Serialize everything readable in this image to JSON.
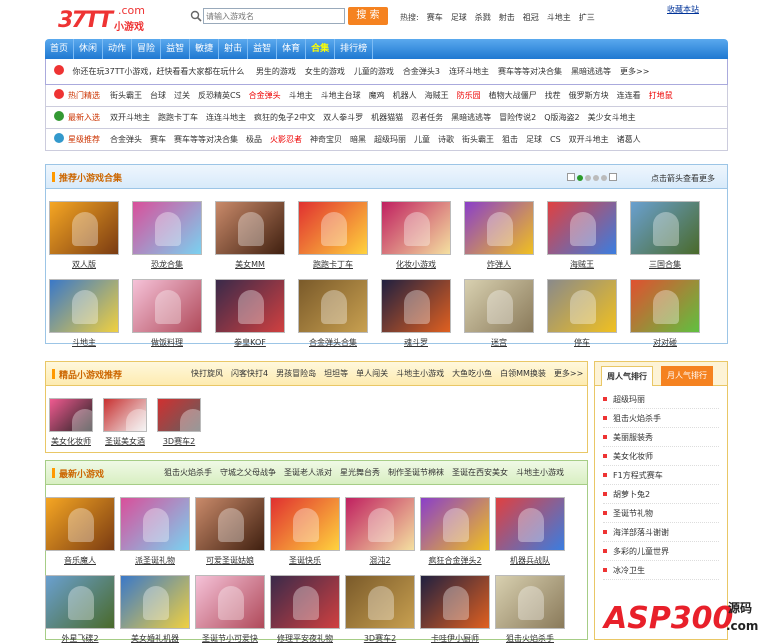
{
  "header": {
    "logo_main": "37TT",
    "logo_com": ".com",
    "logo_sub": "小游戏",
    "search_placeholder": "请输入游戏名",
    "search_button": "搜 索",
    "hot_label": "热搜:",
    "hot_words": [
      "赛车",
      "足球",
      "杀戮",
      "射击",
      "祖冠",
      "斗地主",
      "扩三"
    ],
    "favorite": "收藏本站"
  },
  "nav": {
    "items": [
      "首页",
      "休闲",
      "动作",
      "冒险",
      "益智",
      "敏捷",
      "射击",
      "益智",
      "体育",
      "合集",
      "排行榜"
    ],
    "active_index": 9
  },
  "welcome": {
    "text": "你还在玩37TT小游戏，赶快看看大家都在玩什么",
    "links": [
      "男生的游戏",
      "女生的游戏",
      "儿童的游戏",
      "合金弹头3",
      "连环斗地主",
      "赛车等等对决合集",
      "黑暗逃逃等",
      "更多>>"
    ]
  },
  "rows": [
    {
      "title": "热门精选",
      "color": "#e33",
      "items": [
        {
          "t": "街头霸王"
        },
        {
          "t": "台球"
        },
        {
          "t": "过关"
        },
        {
          "t": "反恐精英CS"
        },
        {
          "t": "合金弹头",
          "red": true
        },
        {
          "t": "斗地主"
        },
        {
          "t": "斗地主台球"
        },
        {
          "t": "魔鸡"
        },
        {
          "t": "机器人"
        },
        {
          "t": "海贼王"
        },
        {
          "t": "防乐园",
          "red": true
        },
        {
          "t": "植物大战僵尸"
        },
        {
          "t": "找茬"
        },
        {
          "t": "俄罗斯方块"
        },
        {
          "t": "连连看"
        },
        {
          "t": "打地鼠",
          "red": true
        }
      ]
    },
    {
      "title": "最新入选",
      "color": "#393",
      "items": [
        {
          "t": "双开斗地主"
        },
        {
          "t": "跑跑卡丁车"
        },
        {
          "t": "连连斗地主"
        },
        {
          "t": "疯狂的兔子2中文"
        },
        {
          "t": "双人拳斗罗"
        },
        {
          "t": "机器猫猫"
        },
        {
          "t": "忍者任务"
        },
        {
          "t": "黑暗逃逃等"
        },
        {
          "t": "冒险传说2"
        },
        {
          "t": "Q版海盗2"
        },
        {
          "t": "美少女斗地主"
        }
      ]
    },
    {
      "title": "星级推荐",
      "color": "#39c",
      "items": [
        {
          "t": "合金弹头"
        },
        {
          "t": "赛车"
        },
        {
          "t": "赛车等等对决合集"
        },
        {
          "t": "极品"
        },
        {
          "t": "火影忍者",
          "red": true
        },
        {
          "t": "神奇宝贝"
        },
        {
          "t": "暗黑"
        },
        {
          "t": "超级玛丽"
        },
        {
          "t": "儿童"
        },
        {
          "t": "诗歌"
        },
        {
          "t": "街头霸王"
        },
        {
          "t": "狙击"
        },
        {
          "t": "足球"
        },
        {
          "t": "CS"
        },
        {
          "t": "双开斗地主"
        },
        {
          "t": "诸葛人"
        }
      ]
    }
  ],
  "recommend": {
    "title": "推荐小游戏合集",
    "more": "点击箭头查看更多",
    "games": [
      "双人版",
      "恐龙合集",
      "美女MM",
      "跑跑卡丁车",
      "化妆小游戏",
      "炸弹人",
      "海贼王",
      "三国合集",
      "斗地主",
      "做饭料理",
      "拳皇KOF",
      "合金弹头合集",
      "魂斗罗",
      "迷宫",
      "停车",
      "对对碰"
    ]
  },
  "picks": {
    "title": "精品小游戏推荐",
    "links": [
      "快打旋风",
      "闪客快打4",
      "男孩冒险岛",
      "坦坦等",
      "单人闯关",
      "斗地主小游戏",
      "大鱼吃小鱼",
      "白领MM换装",
      "更多>>"
    ],
    "games": [
      "美女化妆师",
      "圣诞美女酒",
      "3D赛车2"
    ]
  },
  "newest": {
    "title": "最新小游戏",
    "links": [
      "狙击火焰杀手",
      "守城之父母战争",
      "圣诞老人派对",
      "星光舞台秀",
      "制作圣诞节棉袜",
      "圣诞在西安美女",
      "斗地主小游戏"
    ],
    "games": [
      "音乐魔人",
      "派圣诞礼物",
      "可爱圣诞姑娘",
      "圣诞快乐",
      "混沌2",
      "疯狂合金弹头2",
      "机器兵战队",
      "外星飞碟2",
      "美女婚礼机器",
      "圣诞节小可爱快",
      "修理平安夜礼物",
      "3D赛车2",
      "卡哇伊小厨师",
      "狙击火焰杀手"
    ]
  },
  "rank": {
    "tab1": "周人气排行",
    "tab2": "月人气排行",
    "items": [
      "超级玛丽",
      "狙击火焰杀手",
      "美丽服装秀",
      "美女化妆师",
      "F1方程式赛车",
      "胡萝卜兔2",
      "圣诞节礼物",
      "海洋部落斗谢谢",
      "多彩的儿童世界",
      "冰冷卫生"
    ]
  },
  "watermark": {
    "brand": "ASP300",
    "sub": "源码",
    "domain": ".com"
  },
  "colors": {
    "nav": "#1f78d1",
    "search": "#f58220",
    "accent": "#e33"
  }
}
